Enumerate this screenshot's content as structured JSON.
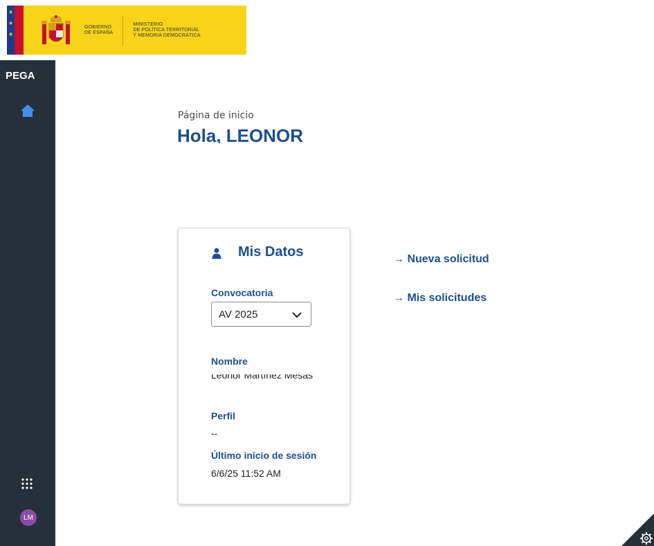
{
  "banner": {
    "gov_line1": "GOBIERNO",
    "gov_line2": "DE ESPAÑA",
    "ministry_line1": "MINISTERIO",
    "ministry_line2": "DE POLÍTICA TERRITORIAL",
    "ministry_line3": "Y MEMORIA DEMOCRÁTICA"
  },
  "sidebar": {
    "brand": "PEGA",
    "avatar_initials": "LM",
    "icons": [
      "home-icon",
      "apps-grid-icon"
    ]
  },
  "main": {
    "breadcrumb": "Página de inicio",
    "greeting": "Hola, LEONOR"
  },
  "card": {
    "title": "Mis Datos",
    "convocatoria_label": "Convocatoria",
    "convocatoria_value": "AV 2025",
    "nombre_label": "Nombre",
    "nombre_value": "Leonor Martínez Mesas",
    "perfil_label": "Perfil",
    "perfil_value": "--",
    "ultimo_label": "Último inicio de sesión",
    "ultimo_value": "6/6/25 11:52 AM"
  },
  "links": {
    "nueva": "→ Nueva solicitud",
    "mis": "→ Mis solicitudes"
  },
  "colors": {
    "banner": "#f7d31a",
    "sidebar": "#25303b",
    "accent": "#1f4e8c",
    "avatar": "#8b4ca6",
    "home_icon": "#4a90e2"
  }
}
